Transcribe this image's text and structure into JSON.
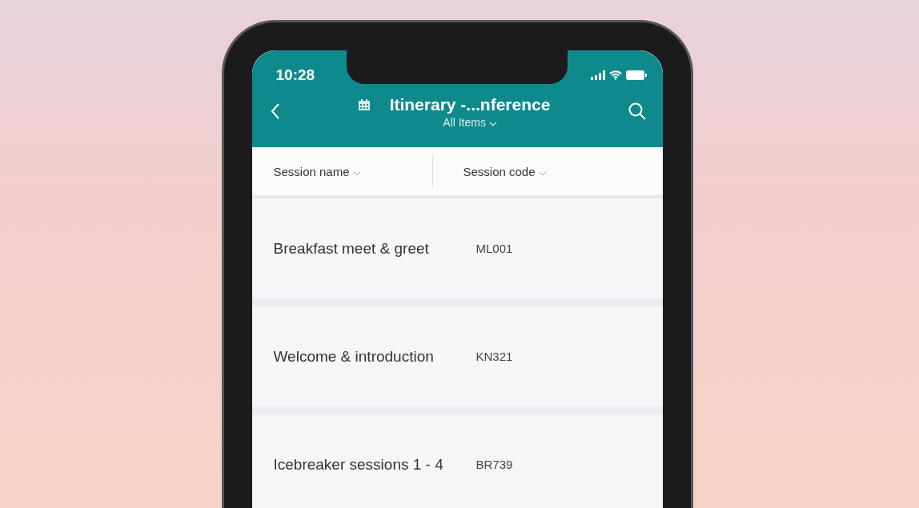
{
  "status_bar": {
    "time": "10:28"
  },
  "header": {
    "title": "Itinerary -...nference",
    "view": "All Items"
  },
  "columns": [
    {
      "label": "Session name"
    },
    {
      "label": "Session code"
    }
  ],
  "rows": [
    {
      "session_name": "Breakfast meet & greet",
      "session_code": "ML001"
    },
    {
      "session_name": "Welcome & introduction",
      "session_code": "KN321"
    },
    {
      "session_name": "Icebreaker sessions 1 - 4",
      "session_code": "BR739"
    }
  ]
}
